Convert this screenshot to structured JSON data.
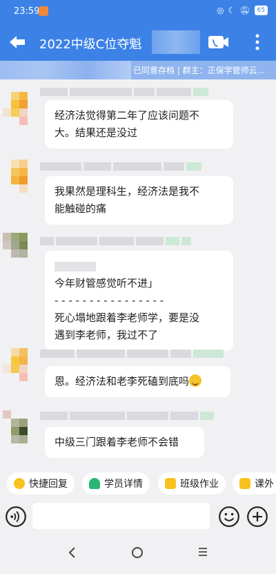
{
  "status_bar": {
    "time": "23:59",
    "battery": "65"
  },
  "header": {
    "title": "2022中级C位夺魁"
  },
  "banner": {
    "text": "已同意存档 | 群主：正保学管师云..."
  },
  "messages": [
    {
      "lines": [
        "经济法觉得第二年了应该问题不",
        "大。结果还是没过"
      ]
    },
    {
      "lines": [
        "我果然是理科生，经济法是我不",
        "能触碰的痛"
      ]
    },
    {
      "quote": "今年财管感觉听不进」",
      "divider": "- - - - - - - - - - - - - - - -",
      "lines": [
        "死心塌地跟着李老师学，要是没",
        "遇到李老师，我过不了"
      ]
    },
    {
      "lines": [
        "恩。经济法和老李死磕到底吗"
      ]
    },
    {
      "lines": [
        "中级三门跟着李老师不会错"
      ]
    }
  ],
  "quick_actions": [
    {
      "label": "快捷回复",
      "icon": "reply-icon",
      "color": "#f7c21d"
    },
    {
      "label": "学员详情",
      "icon": "user-icon",
      "color": "#2bb673"
    },
    {
      "label": "班级作业",
      "icon": "homework-icon",
      "color": "#f7c21d"
    },
    {
      "label": "课外",
      "icon": "extra-icon",
      "color": "#f7c21d"
    }
  ],
  "input": {
    "placeholder": ""
  },
  "colors": {
    "header_bg": "#3c82e6",
    "banner_bg": "#8fb4ee",
    "chat_bg": "#f1f1f3"
  }
}
